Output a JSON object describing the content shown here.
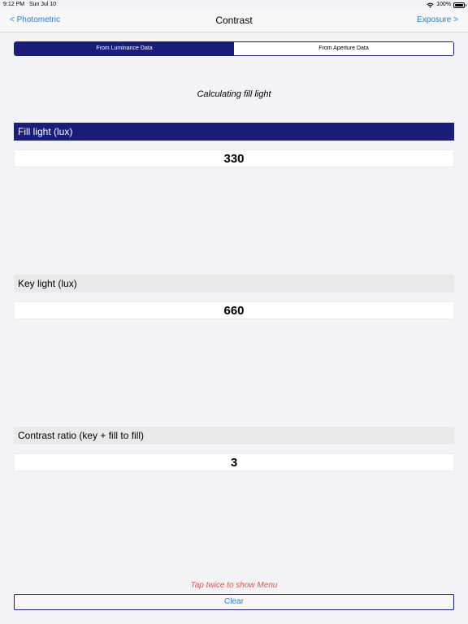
{
  "status_bar": {
    "time": "9:12 PM",
    "date": "Sun Jul 10",
    "battery": "100%"
  },
  "nav": {
    "back_label": "< Photometric",
    "title": "Contrast",
    "forward_label": "Exposure >"
  },
  "segments": [
    {
      "label": "From Luminance Data",
      "selected": true
    },
    {
      "label": "From Aperture Data",
      "selected": false
    }
  ],
  "mode_heading": "Calculating fill light",
  "sections": {
    "fill": {
      "label": "Fill light (lux)",
      "value": "330"
    },
    "key": {
      "label": "Key light (lux)",
      "value": "660"
    },
    "ratio": {
      "label": "Contrast ratio (key + fill to fill)",
      "value": "3"
    }
  },
  "hint": "Tap twice to show Menu",
  "clear_label": "Clear",
  "colors": {
    "accent": "#1a1d7a",
    "link": "#2a7ad5",
    "hint": "#d9534f",
    "background": "#f2f2f7"
  }
}
